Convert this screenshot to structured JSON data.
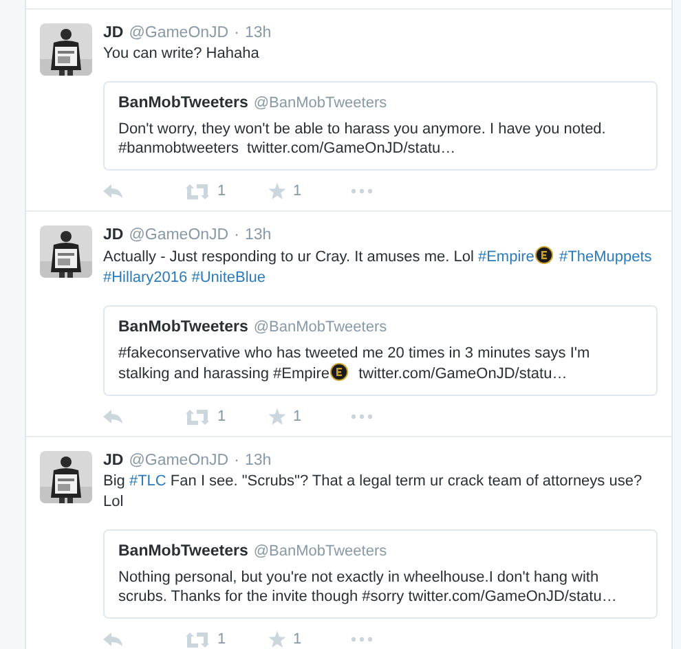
{
  "tweets": [
    {
      "author": {
        "name": "JD",
        "handle": "@GameOnJD",
        "separator": "·",
        "time": "13h"
      },
      "text": [
        {
          "kind": "plain",
          "text": "You can write? Hahaha"
        }
      ],
      "quote": {
        "name": "BanMobTweeters",
        "handle": "@BanMobTweeters",
        "text": [
          {
            "kind": "plain",
            "text": "Don't worry, they won't be able to harass you anymore. I have you noted. #banmobtweeters  twitter.com/GameOnJD/statu…"
          }
        ]
      },
      "retweets": "1",
      "likes": "1"
    },
    {
      "author": {
        "name": "JD",
        "handle": "@GameOnJD",
        "separator": "·",
        "time": "13h"
      },
      "text": [
        {
          "kind": "plain",
          "text": "Actually - Just responding to ur Cray. It amuses me. Lol "
        },
        {
          "kind": "hashtag",
          "text": "#Empire"
        },
        {
          "kind": "emoji"
        },
        {
          "kind": "space"
        },
        {
          "kind": "hashtag",
          "text": "#TheMuppets"
        },
        {
          "kind": "space"
        },
        {
          "kind": "hashtag",
          "text": "#Hillary2016"
        },
        {
          "kind": "space"
        },
        {
          "kind": "hashtag",
          "text": "#UniteBlue"
        }
      ],
      "quote": {
        "name": "BanMobTweeters",
        "handle": "@BanMobTweeters",
        "text": [
          {
            "kind": "plain",
            "text": "#fakeconservative who has tweeted me 20 times in 3 minutes says I'm stalking and harassing #Empire"
          },
          {
            "kind": "emoji"
          },
          {
            "kind": "plain",
            "text": "  twitter.com/GameOnJD/statu…"
          }
        ]
      },
      "retweets": "1",
      "likes": "1"
    },
    {
      "author": {
        "name": "JD",
        "handle": "@GameOnJD",
        "separator": "·",
        "time": "13h"
      },
      "text": [
        {
          "kind": "plain",
          "text": "Big "
        },
        {
          "kind": "hashtag",
          "text": "#TLC"
        },
        {
          "kind": "plain",
          "text": " Fan I see. \"Scrubs\"? That a legal term ur crack team of attorneys use? Lol"
        }
      ],
      "quote": {
        "name": "BanMobTweeters",
        "handle": "@BanMobTweeters",
        "text": [
          {
            "kind": "plain",
            "text": "Nothing personal, but you're not exactly in wheelhouse.I don't hang with scrubs. Thanks for the invite though #sorry twitter.com/GameOnJD/statu…"
          }
        ]
      },
      "retweets": "1",
      "likes": "1"
    }
  ]
}
